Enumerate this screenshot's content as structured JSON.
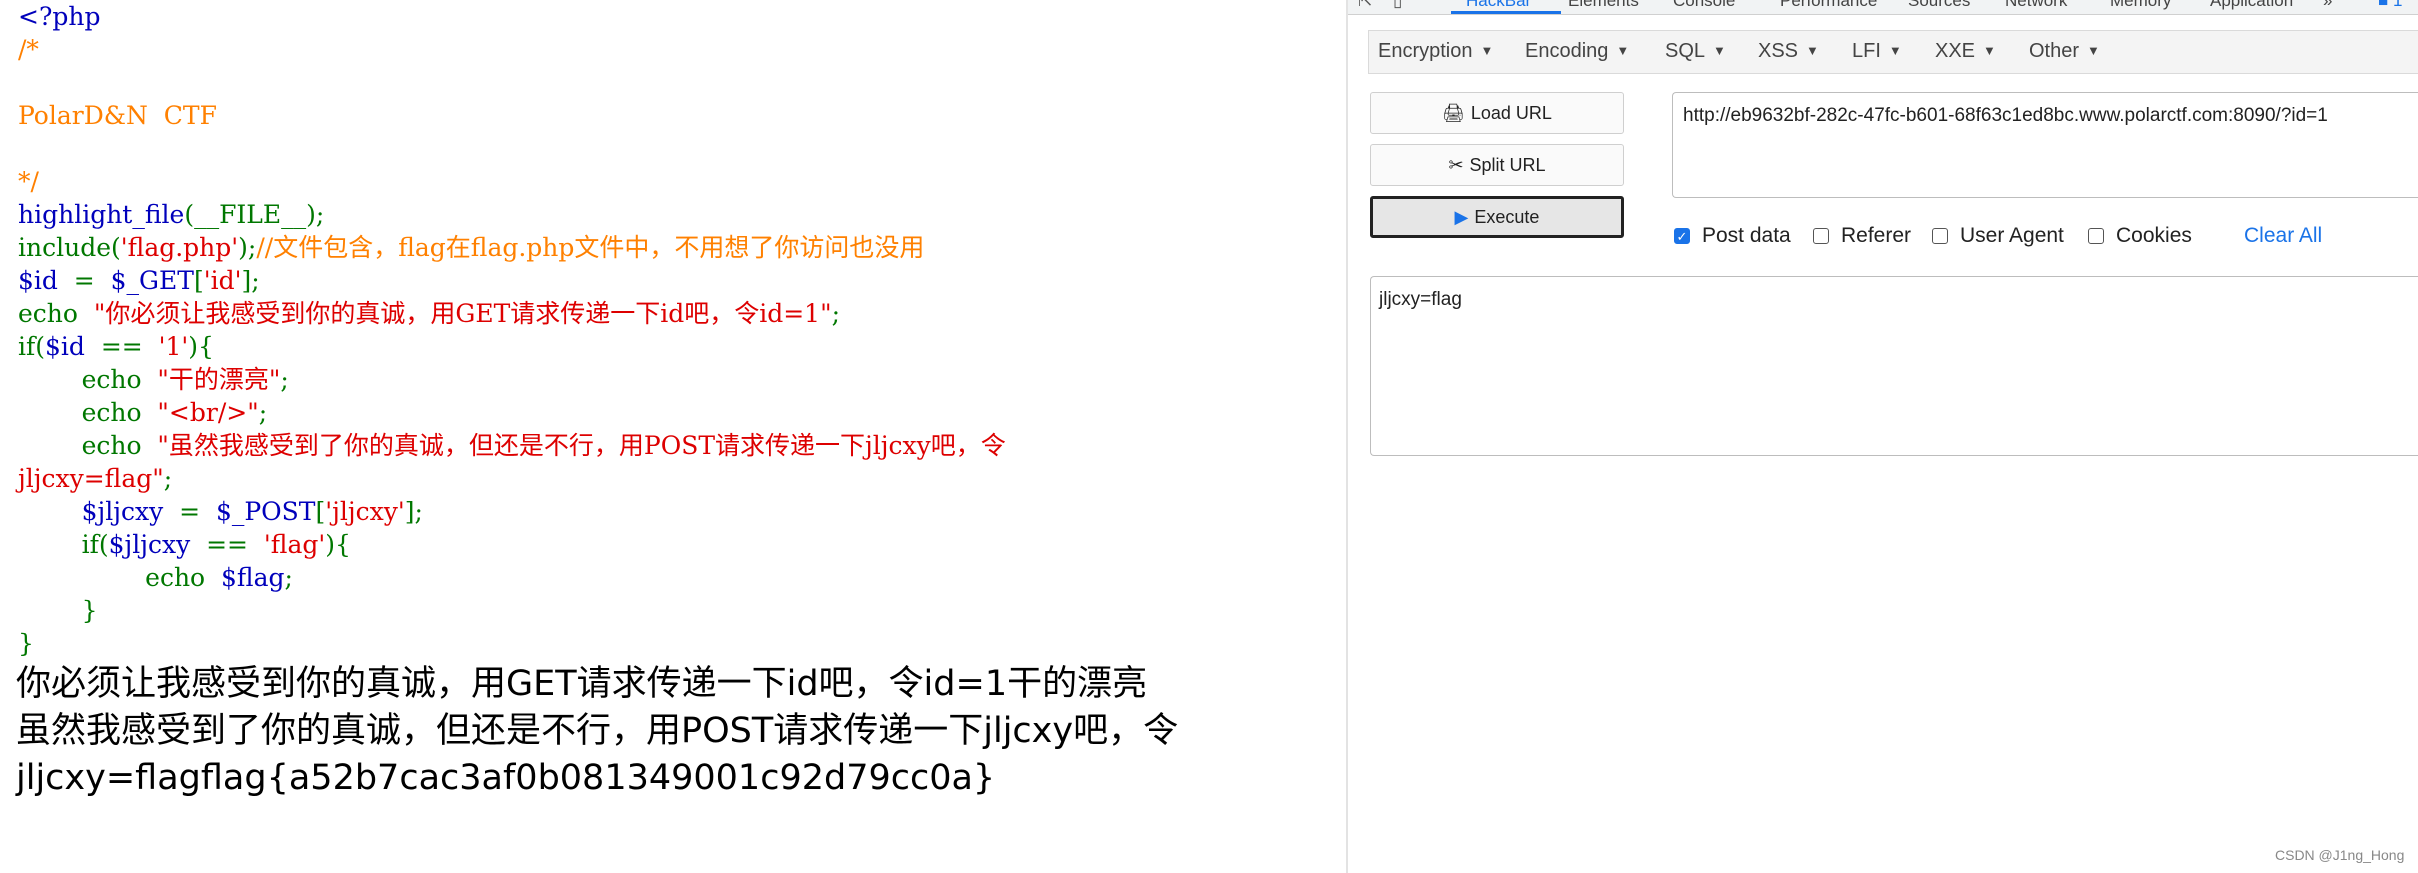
{
  "source_code": {
    "php_open": "<?php",
    "comment_open": "/*",
    "comment_title": "PolarD&N  CTF",
    "comment_close": "*/",
    "line_highlight_fn": "highlight_file",
    "line_highlight_arg": "(__FILE__)",
    "line_highlight_end": ";",
    "line_include_fn": "include",
    "line_include_paren_open": "(",
    "line_include_arg": "'flag.php'",
    "line_include_paren_close": ");",
    "line_include_comment": "//文件包含，flag在flag.php文件中，不用想了你访问也没用",
    "line_id_var": "$id",
    "line_id_eq": "  =  ",
    "line_id_get": "$_GET",
    "line_id_bracket_open": "[",
    "line_id_key": "'id'",
    "line_id_bracket_close": "];",
    "line_echo1_kw": "echo  ",
    "line_echo1_str": "\"你必须让我感受到你的真诚，用GET请求传递一下id吧，令id=1\"",
    "line_echo1_end": ";",
    "line_if1_kw": "if(",
    "line_if1_var": "$id",
    "line_if1_op": "  ==  ",
    "line_if1_val": "'1'",
    "line_if1_end": "){",
    "line_echo2_kw": "        echo  ",
    "line_echo2_str": "\"干的漂亮\"",
    "line_echo2_end": ";",
    "line_echo3_kw": "        echo  ",
    "line_echo3_str": "\"<br/>\"",
    "line_echo3_end": ";",
    "line_echo4_kw": "        echo  ",
    "line_echo4_str_a": "\"虽然我感受到了你的真诚，但还是不行，用POST请求传递一下jljcxy吧，令",
    "line_echo4_str_b": "jljcxy=flag\"",
    "line_echo4_end": ";",
    "line_post_indent": "        ",
    "line_post_var": "$jljcxy",
    "line_post_eq": "  =  ",
    "line_post_arr": "$_POST",
    "line_post_bracket_open": "[",
    "line_post_key": "'jljcxy'",
    "line_post_bracket_close": "];",
    "line_if2_kw": "        if(",
    "line_if2_var": "$jljcxy",
    "line_if2_op": "  ==  ",
    "line_if2_val": "'flag'",
    "line_if2_end": "){",
    "line_echo5_kw": "                echo  ",
    "line_echo5_var": "$flag",
    "line_echo5_end": ";",
    "line_close_inner": "        }",
    "line_close_outer": "}"
  },
  "page_output": {
    "line1": "你必须让我感受到你的真诚，用GET请求传递一下id吧，令id=1干的漂亮",
    "line2": "虽然我感受到了你的真诚，但还是不行，用POST请求传递一下jljcxy吧，令",
    "line3": "jljcxy=flagflag{a52b7cac3af0b081349001c92d79cc0a}"
  },
  "devtools": {
    "tabs": [
      "HackBar",
      "Elements",
      "Console",
      "Performance",
      "Sources",
      "Network",
      "Memory",
      "Application"
    ],
    "active_tab": "HackBar",
    "more_tabs": "»",
    "issues_count": "1"
  },
  "hackbar": {
    "menus": [
      "Encryption",
      "Encoding",
      "SQL",
      "XSS",
      "LFI",
      "XXE",
      "Other"
    ],
    "load_url_label": "Load URL",
    "split_url_label": "Split URL",
    "execute_label": "Execute",
    "url_value": "http://eb9632bf-282c-47fc-b601-68f63c1ed8bc.www.polarctf.com:8090/?id=1",
    "options": {
      "post_data": {
        "label": "Post data",
        "checked": true
      },
      "referer": {
        "label": "Referer",
        "checked": false
      },
      "user_agent": {
        "label": "User Agent",
        "checked": false
      },
      "cookies": {
        "label": "Cookies",
        "checked": false
      }
    },
    "clear_all_label": "Clear All",
    "post_body": "jljcxy=flag"
  },
  "watermark": "CSDN @J1ng_Hong",
  "colors": {
    "php_keyword": "#007700",
    "php_variable": "#0000BB",
    "php_string": "#DD0000",
    "php_comment": "#FF8000",
    "accent": "#1a73e8"
  }
}
